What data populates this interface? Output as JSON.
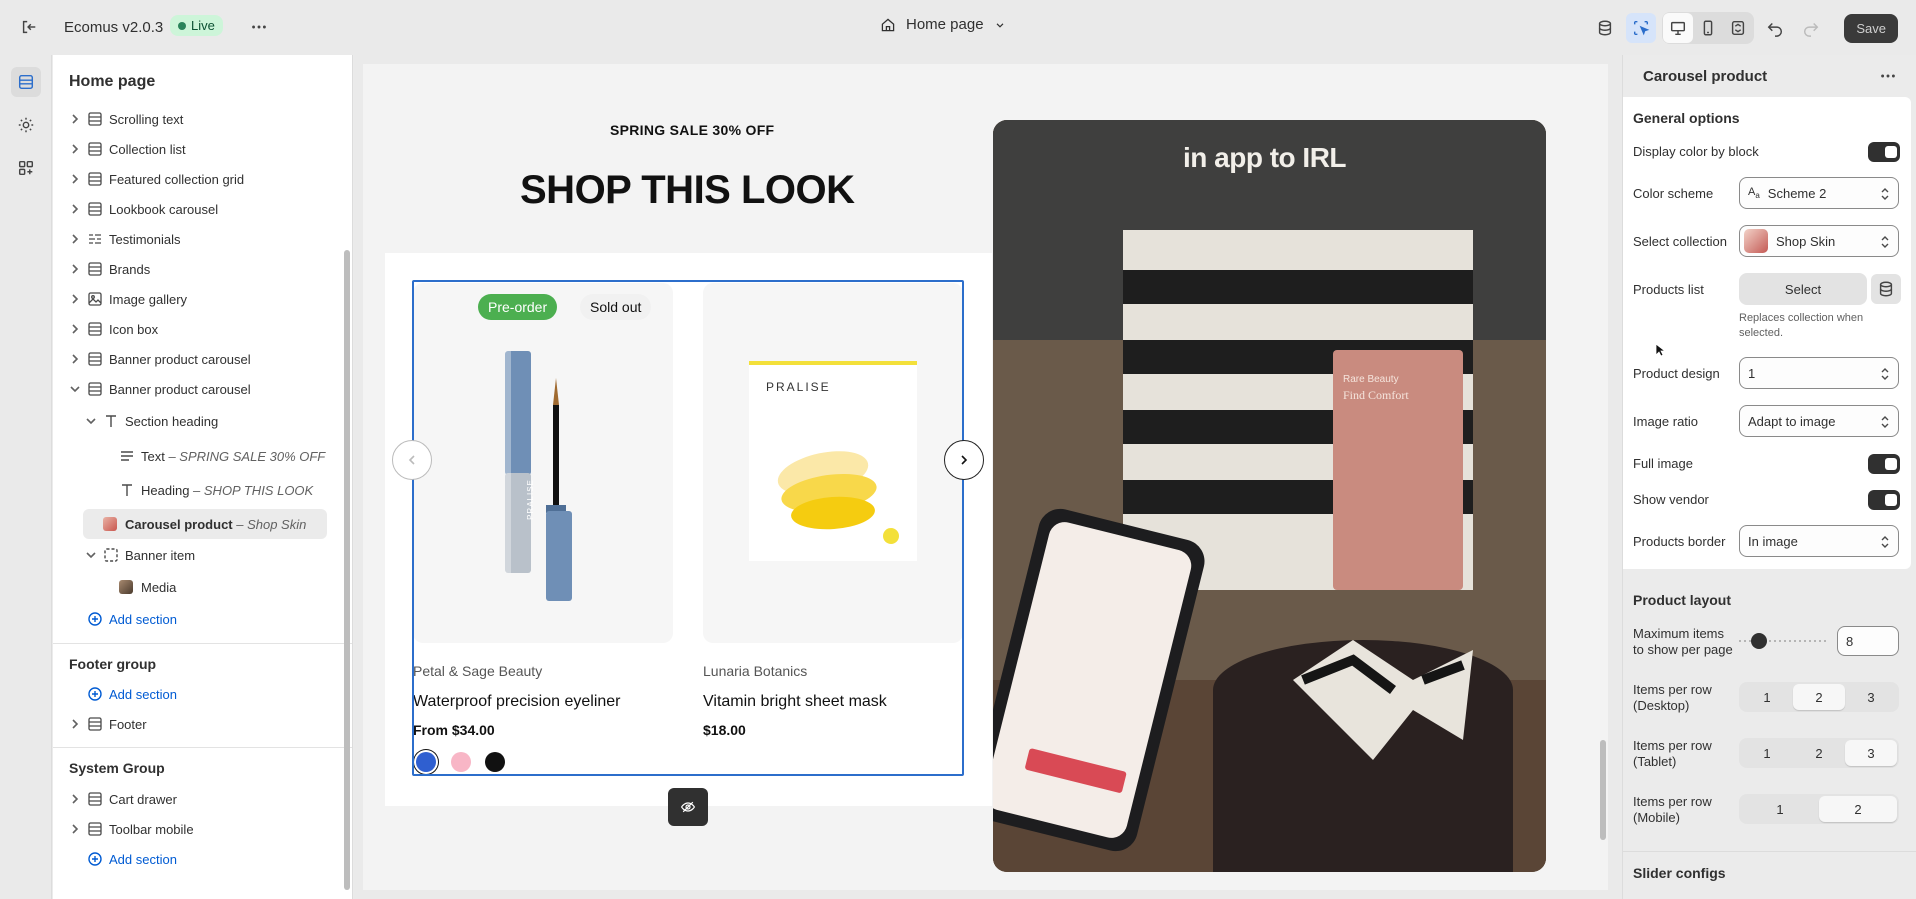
{
  "topbar": {
    "app_name": "Ecomus v2.0.3",
    "live_label": "Live",
    "page_selector": "Home page",
    "save_label": "Save"
  },
  "sidebar": {
    "title": "Home page",
    "items": [
      {
        "label": "Scrolling text",
        "icon": "section-icon"
      },
      {
        "label": "Collection list",
        "icon": "section-icon"
      },
      {
        "label": "Featured collection grid",
        "icon": "section-icon"
      },
      {
        "label": "Lookbook carousel",
        "icon": "section-icon"
      },
      {
        "label": "Testimonials",
        "icon": "list-icon"
      },
      {
        "label": "Brands",
        "icon": "section-icon"
      },
      {
        "label": "Image gallery",
        "icon": "image-icon"
      },
      {
        "label": "Icon box",
        "icon": "section-icon"
      },
      {
        "label": "Banner product carousel",
        "icon": "section-icon"
      },
      {
        "label": "Banner product carousel",
        "icon": "section-icon"
      }
    ],
    "section_heading": "Section heading",
    "text_block": {
      "label": "Text",
      "sub": " – SPRING SALE 30% OFF"
    },
    "heading_block": {
      "label": "Heading",
      "sub": " – SHOP THIS LOOK"
    },
    "carousel_block": {
      "label": "Carousel product",
      "sub": " – Shop Skin"
    },
    "banner_item": "Banner item",
    "media": "Media",
    "add_section": "Add section",
    "footer_group": "Footer group",
    "footer": "Footer",
    "system_group": "System Group",
    "cart_drawer": "Cart drawer",
    "toolbar_mobile": "Toolbar mobile"
  },
  "preview": {
    "sale_text": "SPRING SALE 30% OFF",
    "look_title": "SHOP THIS LOOK",
    "photo_caption": "in app to IRL",
    "products": [
      {
        "badges": [
          "Pre-order",
          "Sold out"
        ],
        "vendor": "Petal & Sage Beauty",
        "name": "Waterproof precision eyeliner",
        "price": "From $34.00",
        "swatches": [
          "#2f5fd0",
          "#f8b6c6",
          "#111111"
        ],
        "pack_text": "PRALISE"
      },
      {
        "vendor": "Lunaria Botanics",
        "name": "Vitamin bright sheet mask",
        "price": "$18.00",
        "pack_text": "PRALISE"
      }
    ],
    "box_text": {
      "line1": "Rare Beauty",
      "line2": "Find Comfort"
    }
  },
  "panel": {
    "title": "Carousel product",
    "general_options": "General options",
    "display_color": "Display color by block",
    "color_scheme_label": "Color scheme",
    "color_scheme_value": "Scheme 2",
    "select_collection_label": "Select collection",
    "select_collection_value": "Shop Skin",
    "products_list_label": "Products list",
    "products_list_button": "Select",
    "products_list_hint": "Replaces collection when selected.",
    "product_design_label": "Product design",
    "product_design_value": "1",
    "image_ratio_label": "Image ratio",
    "image_ratio_value": "Adapt to image",
    "full_image_label": "Full image",
    "show_vendor_label": "Show vendor",
    "products_border_label": "Products border",
    "products_border_value": "In image",
    "product_layout": "Product layout",
    "max_items_label": "Maximum items to show per page",
    "max_items_value": "8",
    "per_row_desktop_label": "Items per row (Desktop)",
    "per_row_desktop": {
      "options": [
        "1",
        "2",
        "3"
      ],
      "selected": "2"
    },
    "per_row_tablet_label": "Items per row (Tablet)",
    "per_row_tablet": {
      "options": [
        "1",
        "2",
        "3"
      ],
      "selected": "3"
    },
    "per_row_mobile_label": "Items per row (Mobile)",
    "per_row_mobile": {
      "options": [
        "1",
        "2"
      ],
      "selected": "2"
    },
    "slider_configs": "Slider configs"
  },
  "colors": {
    "accent": "#2c6ecb",
    "preorder_badge": "#4caf50",
    "live_badge": "#cdf5d9"
  }
}
